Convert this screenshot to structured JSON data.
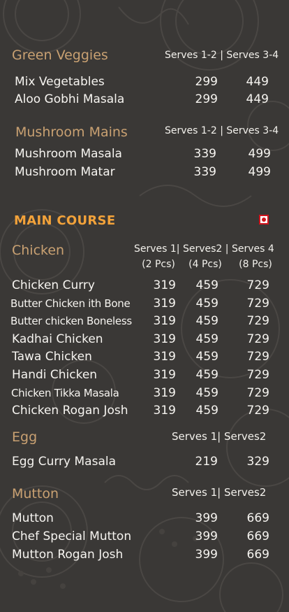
{
  "green_veggies": {
    "title": "Green Veggies",
    "serves_header": "Serves 1-2 | Serves 3-4",
    "items": [
      {
        "name": "Mix Vegetables",
        "price_1": "299",
        "price_2": "449"
      },
      {
        "name": "Aloo Gobhi Masala",
        "price_1": "299",
        "price_2": "449"
      }
    ]
  },
  "mushroom_mains": {
    "title": "Mushroom Mains",
    "serves_header": "Serves 1-2 | Serves 3-4",
    "items": [
      {
        "name": "Mushroom Masala",
        "price_1": "339",
        "price_2": "499"
      },
      {
        "name": "Mushroom Matar",
        "price_1": "339",
        "price_2": "499"
      }
    ]
  },
  "main_course": {
    "title": "MAIN COURSE",
    "indicator_color": "#d0141c"
  },
  "chicken": {
    "title": "Chicken",
    "serves_header_line1": "Serves 1| Serves2 | Serves 4",
    "serves_col1_pcs": "(2 Pcs)",
    "serves_col2_pcs": "(4 Pcs)",
    "serves_col3_pcs": "(8 Pcs)",
    "items": [
      {
        "name": "Chicken Curry",
        "price_1": "319",
        "price_2": "459",
        "price_3": "729"
      },
      {
        "name": "Butter Chicken ith Bone",
        "price_1": "319",
        "price_2": "459",
        "price_3": "729"
      },
      {
        "name": "Butter chicken Boneless",
        "price_1": "319",
        "price_2": "459",
        "price_3": "729"
      },
      {
        "name": "Kadhai Chicken",
        "price_1": "319",
        "price_2": "459",
        "price_3": "729"
      },
      {
        "name": "Tawa Chicken",
        "price_1": "319",
        "price_2": "459",
        "price_3": "729"
      },
      {
        "name": "Handi Chicken",
        "price_1": "319",
        "price_2": "459",
        "price_3": "729"
      },
      {
        "name": "Chicken Tikka Masala",
        "price_1": "319",
        "price_2": "459",
        "price_3": "729"
      },
      {
        "name": "Chicken Rogan Josh",
        "price_1": "319",
        "price_2": "459",
        "price_3": "729"
      }
    ]
  },
  "egg": {
    "title": "Egg",
    "serves_header": "Serves 1| Serves2",
    "items": [
      {
        "name": "Egg Curry Masala",
        "price_1": "219",
        "price_2": "329"
      }
    ]
  },
  "mutton": {
    "title": "Mutton",
    "serves_header": "Serves 1| Serves2",
    "items": [
      {
        "name": "Mutton",
        "price_1": "399",
        "price_2": "669"
      },
      {
        "name": "Chef Special Mutton",
        "price_1": "399",
        "price_2": "669"
      },
      {
        "name": "Mutton Rogan Josh",
        "price_1": "399",
        "price_2": "669"
      }
    ]
  },
  "colors": {
    "background": "#3a3836",
    "category": "#c9a172",
    "section": "#f2a23a",
    "text": "#f6f4f0"
  }
}
